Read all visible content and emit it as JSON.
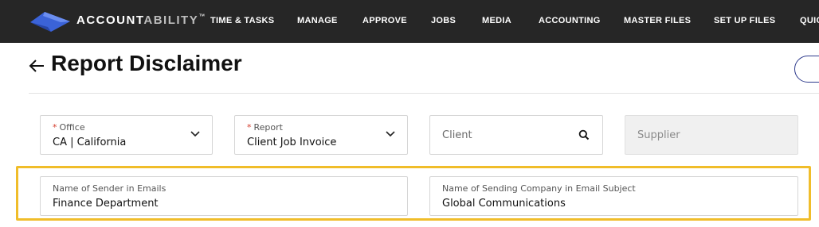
{
  "brand": {
    "bold": "ACCOUNT",
    "light": "ABILITY",
    "tm": "™"
  },
  "nav": {
    "items": [
      "TIME & TASKS",
      "MANAGE",
      "APPROVE",
      "JOBS",
      "MEDIA",
      "ACCOUNTING",
      "MASTER FILES",
      "SET UP FILES",
      "QUIC"
    ]
  },
  "page": {
    "title": "Report Disclaimer"
  },
  "filters": {
    "office": {
      "label": "Office",
      "value": "CA | California"
    },
    "report": {
      "label": "Report",
      "value": "Client Job Invoice"
    },
    "client": {
      "placeholder": "Client"
    },
    "supplier": {
      "placeholder": "Supplier"
    }
  },
  "email": {
    "sender_name": {
      "label": "Name of Sender in Emails",
      "value": "Finance Department"
    },
    "company_name": {
      "label": "Name of Sending Company in Email Subject",
      "value": "Global Communications"
    }
  },
  "colors": {
    "nav_bg": "#262626",
    "logo_blue": "#3b63d8",
    "highlight": "#f0bd2a",
    "required": "#d43a2a"
  }
}
